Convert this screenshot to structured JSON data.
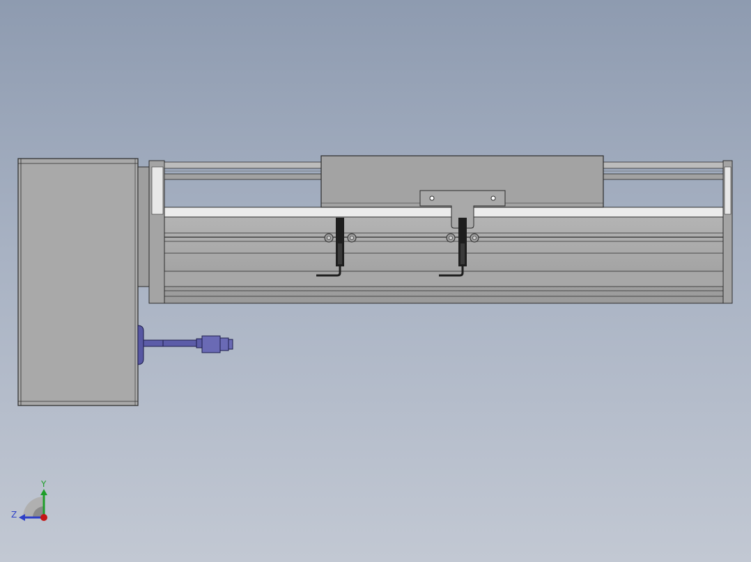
{
  "viewport": {
    "background_top": "#8e9bb0",
    "background_bottom": "#c2c8d3",
    "model_color": "#a6a6a6",
    "edge_color": "#2b2b2b",
    "cable_color": "#5c5ca8"
  },
  "triad": {
    "y_label": "Y",
    "z_label": "Z",
    "y_color": "#1f9e2a",
    "z_color": "#2e3fc7",
    "x_color": "#c41616"
  }
}
